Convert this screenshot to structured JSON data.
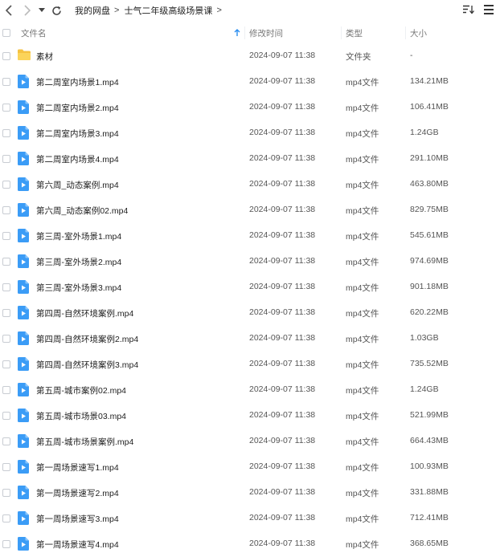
{
  "breadcrumb": [
    "我的网盘",
    "士气二年级高级场景课"
  ],
  "columns": {
    "name": "文件名",
    "modified": "修改时间",
    "type": "类型",
    "size": "大小"
  },
  "colors": {
    "accent": "#2b8ef0",
    "folder": "#f5c242",
    "header_text": "#777777"
  },
  "icons": {
    "back": "back-arrow-icon",
    "forward": "forward-arrow-icon",
    "refresh": "refresh-icon",
    "sort": "sort-icon",
    "view": "view-grid-icon",
    "video": "video-file-icon",
    "folder": "folder-icon"
  },
  "files": [
    {
      "name": "素材",
      "date": "2024-09-07 11:38",
      "type": "文件夹",
      "size": "-",
      "kind": "folder"
    },
    {
      "name": "第二周室内场景1.mp4",
      "date": "2024-09-07 11:38",
      "type": "mp4文件",
      "size": "134.21MB",
      "kind": "video"
    },
    {
      "name": "第二周室内场景2.mp4",
      "date": "2024-09-07 11:38",
      "type": "mp4文件",
      "size": "106.41MB",
      "kind": "video"
    },
    {
      "name": "第二周室内场景3.mp4",
      "date": "2024-09-07 11:38",
      "type": "mp4文件",
      "size": "1.24GB",
      "kind": "video"
    },
    {
      "name": "第二周室内场景4.mp4",
      "date": "2024-09-07 11:38",
      "type": "mp4文件",
      "size": "291.10MB",
      "kind": "video"
    },
    {
      "name": "第六周_动态案例.mp4",
      "date": "2024-09-07 11:38",
      "type": "mp4文件",
      "size": "463.80MB",
      "kind": "video"
    },
    {
      "name": "第六周_动态案例02.mp4",
      "date": "2024-09-07 11:38",
      "type": "mp4文件",
      "size": "829.75MB",
      "kind": "video"
    },
    {
      "name": "第三周-室外场景1.mp4",
      "date": "2024-09-07 11:38",
      "type": "mp4文件",
      "size": "545.61MB",
      "kind": "video"
    },
    {
      "name": "第三周-室外场景2.mp4",
      "date": "2024-09-07 11:38",
      "type": "mp4文件",
      "size": "974.69MB",
      "kind": "video"
    },
    {
      "name": "第三周-室外场景3.mp4",
      "date": "2024-09-07 11:38",
      "type": "mp4文件",
      "size": "901.18MB",
      "kind": "video"
    },
    {
      "name": "第四周-自然环境案例.mp4",
      "date": "2024-09-07 11:38",
      "type": "mp4文件",
      "size": "620.22MB",
      "kind": "video"
    },
    {
      "name": "第四周-自然环境案例2.mp4",
      "date": "2024-09-07 11:38",
      "type": "mp4文件",
      "size": "1.03GB",
      "kind": "video"
    },
    {
      "name": "第四周-自然环境案例3.mp4",
      "date": "2024-09-07 11:38",
      "type": "mp4文件",
      "size": "735.52MB",
      "kind": "video"
    },
    {
      "name": "第五周-城市案例02.mp4",
      "date": "2024-09-07 11:38",
      "type": "mp4文件",
      "size": "1.24GB",
      "kind": "video"
    },
    {
      "name": "第五周-城市场景03.mp4",
      "date": "2024-09-07 11:38",
      "type": "mp4文件",
      "size": "521.99MB",
      "kind": "video"
    },
    {
      "name": "第五周-城市场景案例.mp4",
      "date": "2024-09-07 11:38",
      "type": "mp4文件",
      "size": "664.43MB",
      "kind": "video"
    },
    {
      "name": "第一周场景速写1.mp4",
      "date": "2024-09-07 11:38",
      "type": "mp4文件",
      "size": "100.93MB",
      "kind": "video"
    },
    {
      "name": "第一周场景速写2.mp4",
      "date": "2024-09-07 11:38",
      "type": "mp4文件",
      "size": "331.88MB",
      "kind": "video"
    },
    {
      "name": "第一周场景速写3.mp4",
      "date": "2024-09-07 11:38",
      "type": "mp4文件",
      "size": "712.41MB",
      "kind": "video"
    },
    {
      "name": "第一周场景速写4.mp4",
      "date": "2024-09-07 11:38",
      "type": "mp4文件",
      "size": "368.65MB",
      "kind": "video"
    }
  ]
}
